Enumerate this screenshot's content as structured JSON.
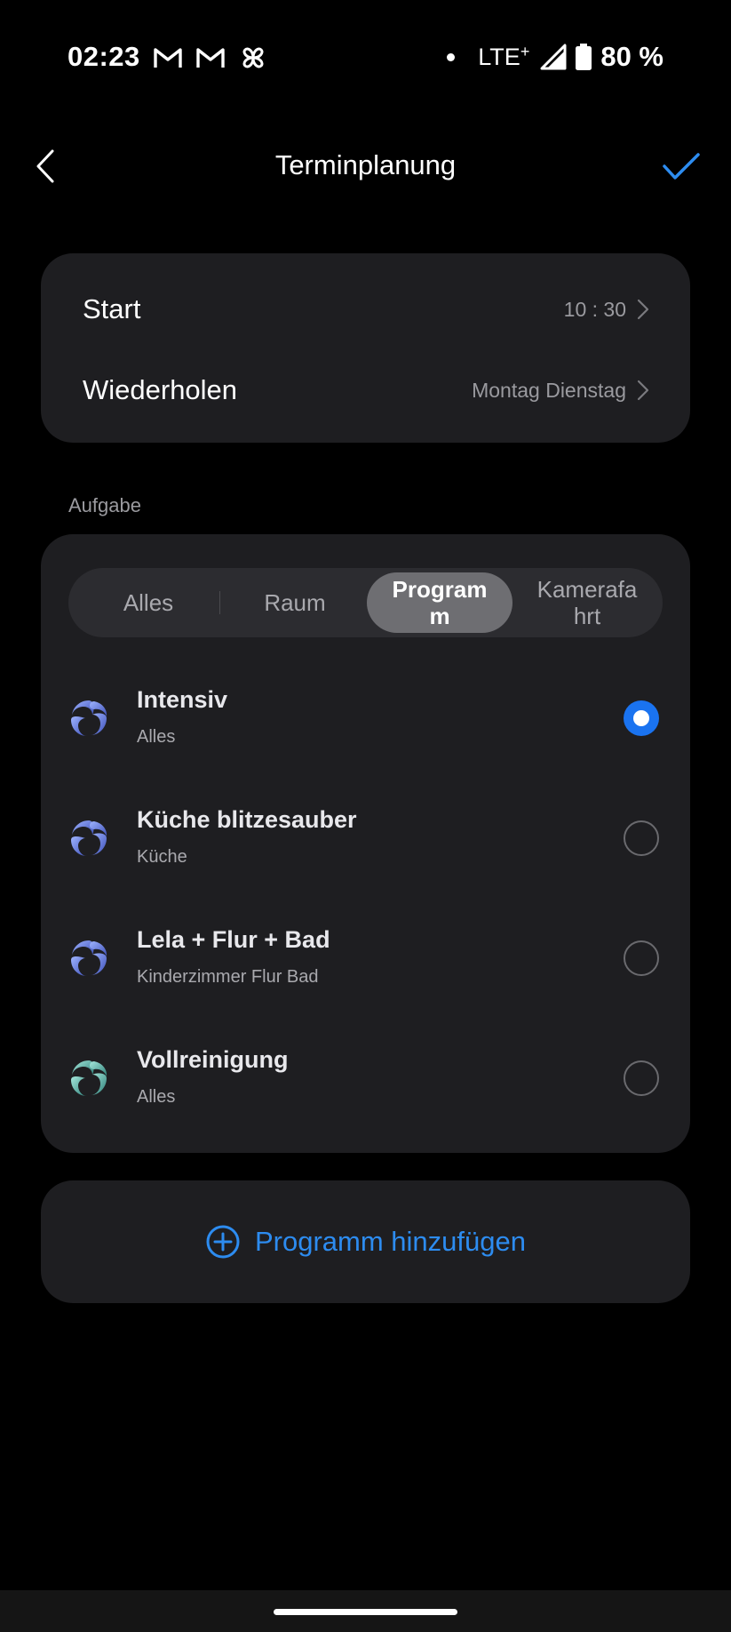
{
  "status_bar": {
    "time": "02:23",
    "network": "LTE",
    "network_plus": "+",
    "battery": "80 %",
    "icons": [
      "gmail-icon",
      "gmail-icon",
      "pinwheel-app-icon",
      "signal-icon",
      "battery-icon"
    ]
  },
  "header": {
    "title": "Terminplanung",
    "back_icon": "chevron-left-icon",
    "confirm_icon": "checkmark-icon"
  },
  "schedule": {
    "start_label": "Start",
    "start_value": "10 : 30",
    "repeat_label": "Wiederholen",
    "repeat_value": "Montag Dienstag"
  },
  "task_section_label": "Aufgabe",
  "tabs": [
    {
      "label": "Alles",
      "active": false
    },
    {
      "label": "Raum",
      "active": false
    },
    {
      "label": "Programm",
      "active": true
    },
    {
      "label": "Kamerafahrt",
      "active": false
    }
  ],
  "programs": [
    {
      "name": "Intensiv",
      "subtitle": "Alles",
      "selected": true,
      "icon": "swirl-blue-icon"
    },
    {
      "name": "Küche blitzesauber",
      "subtitle": "Küche",
      "selected": false,
      "icon": "swirl-blue-icon"
    },
    {
      "name": "Lela + Flur + Bad",
      "subtitle": "Kinderzimmer Flur Bad",
      "selected": false,
      "icon": "swirl-blue-icon"
    },
    {
      "name": "Vollreinigung",
      "subtitle": "Alles",
      "selected": false,
      "icon": "swirl-teal-icon"
    }
  ],
  "add_program_label": "Programm hinzufügen",
  "colors": {
    "accent": "#1a73f0",
    "link": "#2d8cf0",
    "card": "#1e1e21",
    "background": "#000000"
  }
}
